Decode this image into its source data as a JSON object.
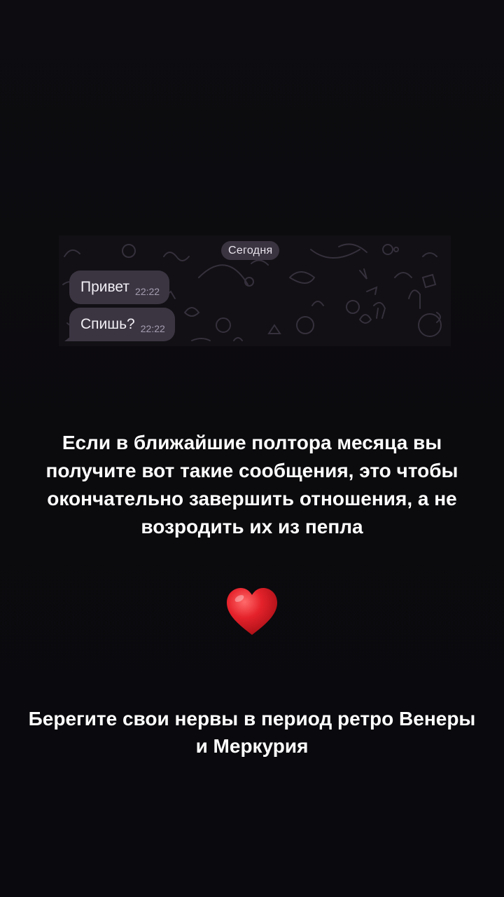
{
  "chat": {
    "date_label": "Сегодня",
    "messages": [
      {
        "text": "Привет",
        "time": "22:22"
      },
      {
        "text": "Спишь?",
        "time": "22:22"
      }
    ],
    "bubble_color": "#3b3542",
    "background_color": "#121014"
  },
  "main_text": "Если в ближайшие полтора месяца вы получите вот такие сообщения, это чтобы окончательно завершить отношения, а не возродить их из пепла",
  "heart": {
    "icon": "red-heart-emoji",
    "color": "#e0242c"
  },
  "footer_text": "Берегите свои нервы в период ретро Венеры и Меркурия",
  "colors": {
    "background": "#0b0a0d",
    "text": "#ffffff"
  }
}
